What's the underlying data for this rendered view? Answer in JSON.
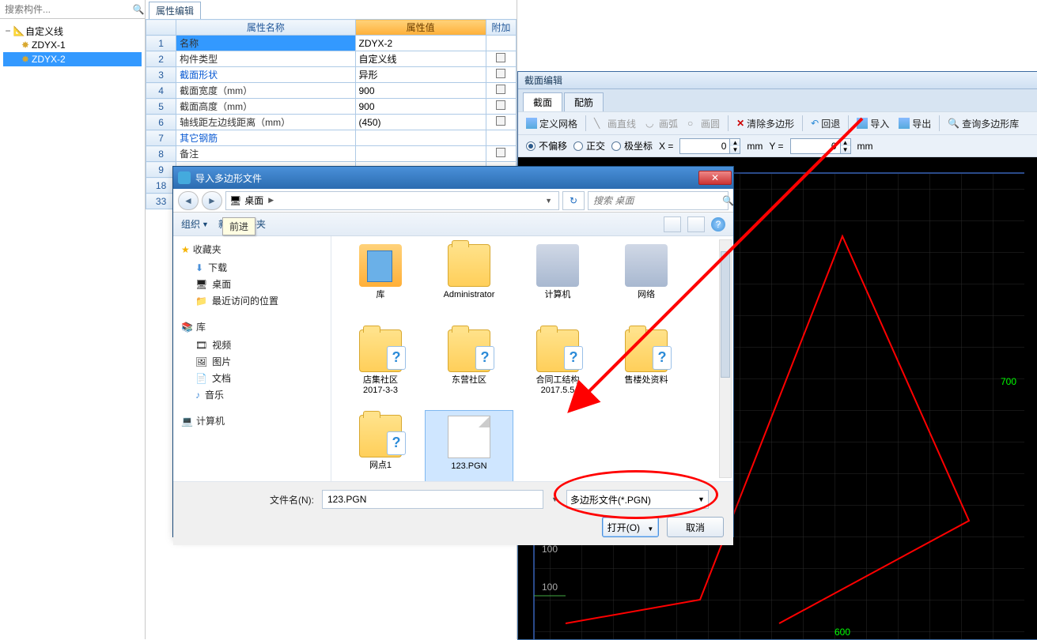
{
  "search_placeholder": "搜索构件...",
  "tree": {
    "root": "自定义线",
    "items": [
      "ZDYX-1",
      "ZDYX-2"
    ],
    "selected": "ZDYX-2"
  },
  "prop": {
    "tab": "属性编辑",
    "headers": {
      "name": "属性名称",
      "value": "属性值",
      "attach": "附加"
    },
    "rows": [
      {
        "n": "1",
        "name": "名称",
        "value": "ZDYX-2",
        "sel": true
      },
      {
        "n": "2",
        "name": "构件类型",
        "value": "自定义线",
        "chk": true
      },
      {
        "n": "3",
        "name": "截面形状",
        "value": "异形",
        "link": true,
        "chk": true
      },
      {
        "n": "4",
        "name": "截面宽度（mm）",
        "value": "900",
        "chk": true
      },
      {
        "n": "5",
        "name": "截面高度（mm）",
        "value": "900",
        "chk": true
      },
      {
        "n": "6",
        "name": "轴线距左边线距离（mm）",
        "value": "(450)",
        "chk": true
      },
      {
        "n": "7",
        "name": "其它钢筋",
        "value": "",
        "link": true
      },
      {
        "n": "8",
        "name": "备注",
        "value": "",
        "chk": true
      },
      {
        "n": "9",
        "name": "",
        "value": ""
      },
      {
        "n": "18",
        "name": "",
        "value": ""
      },
      {
        "n": "33",
        "name": "",
        "value": ""
      }
    ]
  },
  "section": {
    "title": "截面编辑",
    "tabs": [
      "截面",
      "配筋"
    ],
    "toolbar": {
      "grid": "定义网格",
      "line": "画直线",
      "arc": "画弧",
      "circle": "画圆",
      "clear": "清除多边形",
      "undo": "回退",
      "import": "导入",
      "export": "导出",
      "query": "查询多边形库"
    },
    "radios": {
      "noshift": "不偏移",
      "ortho": "正交",
      "polar": "极坐标"
    },
    "coords": {
      "xlabel": "X =",
      "x": "0",
      "ylabel": "Y =",
      "y": "0",
      "unit": "mm"
    },
    "canvas_labels": {
      "w": "700",
      "t1": "100",
      "t2": "100",
      "b": "600"
    }
  },
  "dialog": {
    "title": "导入多边形文件",
    "tooltip": "前进",
    "location_root": "桌面",
    "search_placeholder": "搜索 桌面",
    "organize": "组织",
    "newfolder": "新建文件夹",
    "side": {
      "fav": "收藏夹",
      "fav_items": [
        "下载",
        "桌面",
        "最近访问的位置"
      ],
      "lib": "库",
      "lib_items": [
        "视频",
        "图片",
        "文档",
        "音乐"
      ],
      "computer": "计算机"
    },
    "files_row1": [
      {
        "name": "库",
        "type": "lib"
      },
      {
        "name": "Administrator",
        "type": "folder"
      },
      {
        "name": "计算机",
        "type": "computer"
      },
      {
        "name": "网络",
        "type": "network"
      }
    ],
    "files_row2": [
      {
        "name": "店集社区\n2017-3-3",
        "type": "datafolder"
      },
      {
        "name": "东营社区",
        "type": "datafolder"
      },
      {
        "name": "合同工结构\n2017.5.5",
        "type": "datafolder"
      },
      {
        "name": "售楼处资料",
        "type": "datafolder"
      }
    ],
    "files_row3": [
      {
        "name": "网点1",
        "type": "datafolder"
      },
      {
        "name": "123.PGN",
        "type": "file",
        "sel": true
      }
    ],
    "filename_label": "文件名(N):",
    "filename_value": "123.PGN",
    "filetype": "多边形文件(*.PGN)",
    "open": "打开(O)",
    "cancel": "取消"
  }
}
